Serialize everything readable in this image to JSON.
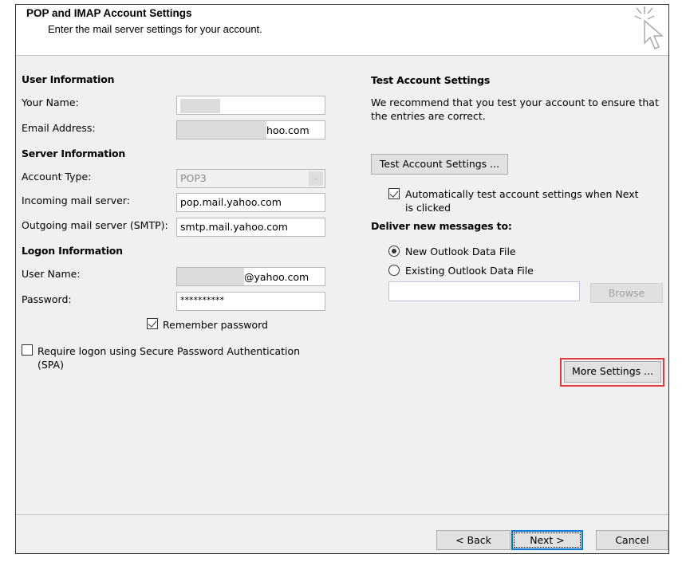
{
  "header": {
    "title": "POP and IMAP Account Settings",
    "subtitle": "Enter the mail server settings for your account.",
    "icon": "cursor-click-icon"
  },
  "user_info": {
    "heading": "User Information",
    "your_name_label": "Your Name:",
    "your_name_value": "",
    "email_label": "Email Address:",
    "email_value": "hoo.com"
  },
  "server_info": {
    "heading": "Server Information",
    "account_type_label": "Account Type:",
    "account_type_value": "POP3",
    "incoming_label": "Incoming mail server:",
    "incoming_value": "pop.mail.yahoo.com",
    "outgoing_label": "Outgoing mail server (SMTP):",
    "outgoing_value": "smtp.mail.yahoo.com"
  },
  "logon_info": {
    "heading": "Logon Information",
    "user_name_label": "User Name:",
    "user_name_value": "@yahoo.com",
    "password_label": "Password:",
    "password_value": "**********",
    "remember_label": "Remember password",
    "remember_checked": true,
    "spa_label_1": "Require logon using Secure Password Authentication",
    "spa_label_2": "(SPA)",
    "spa_checked": false
  },
  "test": {
    "heading": "Test Account Settings",
    "desc_1": "We recommend that you test your account to ensure that",
    "desc_2": "the entries are correct.",
    "button": "Test Account Settings ...",
    "auto_label_1": "Automatically test account settings when Next",
    "auto_label_2": "is clicked",
    "auto_checked": true
  },
  "deliver": {
    "heading": "Deliver new messages to:",
    "new_label": "New Outlook Data File",
    "existing_label": "Existing Outlook Data File",
    "selected": "new",
    "path_value": "",
    "browse": "Browse"
  },
  "more_settings": "More Settings ...",
  "highlight_color": "#e0393e",
  "footer": {
    "back": "< Back",
    "next": "Next >",
    "cancel": "Cancel"
  }
}
